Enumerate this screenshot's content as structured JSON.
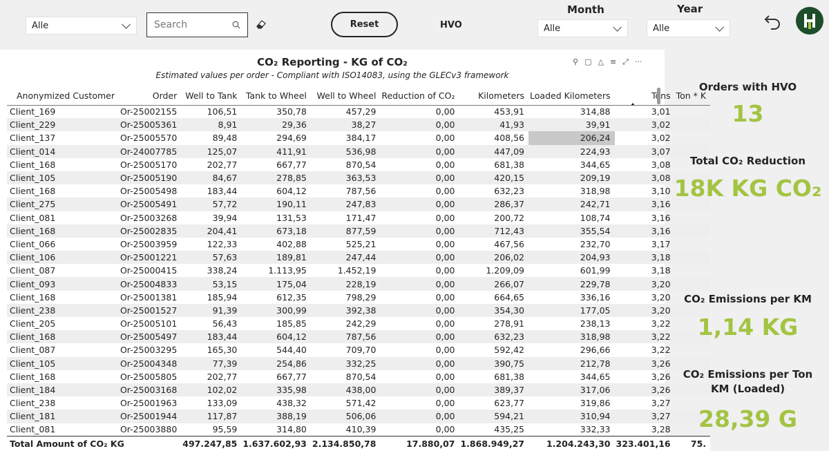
{
  "slicers": {
    "customer": {
      "value": "Alle"
    },
    "search": {
      "placeholder": "Search"
    },
    "reset_label": "Reset",
    "hvo_label": "HVO",
    "month": {
      "title": "Month",
      "value": "Alle"
    },
    "year": {
      "title": "Year",
      "value": "Alle"
    }
  },
  "visual": {
    "title": "CO₂ Reporting - KG of CO₂",
    "subtitle": "Estimated values per order - Compliant with ISO14083, using the GLECv3 framework"
  },
  "table": {
    "columns": [
      "Anonymized Customer",
      "Order",
      "Well to Tank",
      "Tank to Wheel",
      "Well to Wheel",
      "Reduction of CO₂",
      "Kilometers",
      "Loaded Kilometers",
      "Tons",
      "Ton * K"
    ],
    "rows": [
      [
        "Client_169",
        "Or-25002155",
        "106,51",
        "350,78",
        "457,29",
        "0,00",
        "453,91",
        "314,88",
        "3,01",
        ""
      ],
      [
        "Client_229",
        "Or-25005361",
        "8,91",
        "29,36",
        "38,27",
        "0,00",
        "41,93",
        "39,91",
        "3,02",
        ""
      ],
      [
        "Client_137",
        "Or-25005570",
        "89,48",
        "294,69",
        "384,17",
        "0,00",
        "408,56",
        "206,24",
        "3,02",
        ""
      ],
      [
        "Client_014",
        "Or-24007785",
        "125,07",
        "411,91",
        "536,98",
        "0,00",
        "447,09",
        "224,93",
        "3,07",
        ""
      ],
      [
        "Client_168",
        "Or-25005170",
        "202,77",
        "667,77",
        "870,54",
        "0,00",
        "681,38",
        "344,65",
        "3,08",
        ""
      ],
      [
        "Client_105",
        "Or-25005190",
        "84,67",
        "278,85",
        "363,53",
        "0,00",
        "420,15",
        "209,19",
        "3,08",
        ""
      ],
      [
        "Client_168",
        "Or-25005498",
        "183,44",
        "604,12",
        "787,56",
        "0,00",
        "632,23",
        "318,98",
        "3,10",
        ""
      ],
      [
        "Client_275",
        "Or-25005491",
        "57,72",
        "190,11",
        "247,83",
        "0,00",
        "286,37",
        "242,71",
        "3,16",
        ""
      ],
      [
        "Client_081",
        "Or-25003268",
        "39,94",
        "131,53",
        "171,47",
        "0,00",
        "200,72",
        "108,74",
        "3,16",
        ""
      ],
      [
        "Client_168",
        "Or-25002835",
        "204,41",
        "673,18",
        "877,59",
        "0,00",
        "712,43",
        "355,54",
        "3,16",
        ""
      ],
      [
        "Client_066",
        "Or-25003959",
        "122,33",
        "402,88",
        "525,21",
        "0,00",
        "467,56",
        "232,70",
        "3,17",
        ""
      ],
      [
        "Client_106",
        "Or-25001221",
        "57,63",
        "189,81",
        "247,44",
        "0,00",
        "206,02",
        "204,93",
        "3,18",
        ""
      ],
      [
        "Client_087",
        "Or-25000415",
        "338,24",
        "1.113,95",
        "1.452,19",
        "0,00",
        "1.209,09",
        "601,99",
        "3,18",
        ""
      ],
      [
        "Client_093",
        "Or-25004833",
        "53,15",
        "175,04",
        "228,19",
        "0,00",
        "266,07",
        "229,78",
        "3,20",
        ""
      ],
      [
        "Client_168",
        "Or-25001381",
        "185,94",
        "612,35",
        "798,29",
        "0,00",
        "664,65",
        "336,16",
        "3,20",
        ""
      ],
      [
        "Client_238",
        "Or-25001527",
        "91,39",
        "300,99",
        "392,38",
        "0,00",
        "354,30",
        "177,05",
        "3,20",
        ""
      ],
      [
        "Client_205",
        "Or-25005101",
        "56,43",
        "185,85",
        "242,29",
        "0,00",
        "278,91",
        "238,13",
        "3,22",
        ""
      ],
      [
        "Client_168",
        "Or-25005497",
        "183,44",
        "604,12",
        "787,56",
        "0,00",
        "632,23",
        "318,98",
        "3,22",
        ""
      ],
      [
        "Client_087",
        "Or-25003295",
        "165,30",
        "544,40",
        "709,70",
        "0,00",
        "592,42",
        "296,66",
        "3,22",
        ""
      ],
      [
        "Client_105",
        "Or-25004348",
        "77,39",
        "254,86",
        "332,25",
        "0,00",
        "390,75",
        "212,78",
        "3,26",
        ""
      ],
      [
        "Client_168",
        "Or-25005805",
        "202,77",
        "667,77",
        "870,54",
        "0,00",
        "681,38",
        "344,65",
        "3,26",
        ""
      ],
      [
        "Client_184",
        "Or-25003168",
        "102,02",
        "335,98",
        "438,00",
        "0,00",
        "389,37",
        "317,06",
        "3,26",
        ""
      ],
      [
        "Client_238",
        "Or-25001963",
        "133,09",
        "438,32",
        "571,42",
        "0,00",
        "623,77",
        "319,86",
        "3,27",
        ""
      ],
      [
        "Client_181",
        "Or-25001944",
        "117,87",
        "388,19",
        "506,06",
        "0,00",
        "594,21",
        "310,94",
        "3,27",
        ""
      ],
      [
        "Client_081",
        "Or-25003880",
        "95,59",
        "314,80",
        "410,39",
        "0,00",
        "435,25",
        "332,33",
        "3,28",
        ""
      ]
    ],
    "total": [
      "Total Amount of CO₂ KG",
      "",
      "497.247,85",
      "1.637.602,93",
      "2.134.850,78",
      "17.880,07",
      "1.868.949,27",
      "1.204.243,30",
      "323.401,16",
      "75."
    ]
  },
  "kpis": {
    "orders_hvo": {
      "title": "Orders with HVO",
      "value": "13"
    },
    "total_reduction": {
      "title": "Total CO₂ Reduction",
      "value": "18K KG CO₂"
    },
    "per_km": {
      "title": "CO₂ Emissions per KM",
      "value": "1,14 KG"
    },
    "per_ton_km": {
      "title": "CO₂ Emissions per Ton KM (Loaded)",
      "value": "28,39 G"
    }
  },
  "colors": {
    "accent": "#a3c443",
    "logo_bg": "#1e4d2b"
  }
}
